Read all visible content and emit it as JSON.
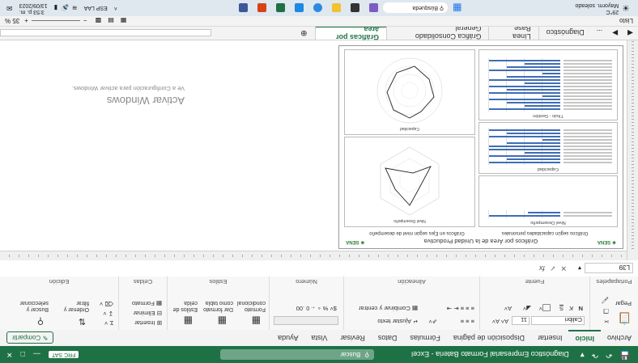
{
  "title_bar": {
    "document_title": "Diagnóstico Empresarial Formato Bateria  -  Excel",
    "search_placeholder": "Buscar",
    "account_label": "FRC SAT",
    "autosave_icon": "save-icon",
    "undo_icon": "undo-icon",
    "redo_icon": "redo-icon"
  },
  "menu": {
    "tabs": [
      "Archivo",
      "Inicio",
      "Insertar",
      "Disposición de página",
      "Fórmulas",
      "Datos",
      "Revisar",
      "Vista",
      "Ayuda"
    ],
    "active_tab": "Inicio",
    "share_label": "Compartir"
  },
  "ribbon": {
    "clipboard": {
      "label": "Portapapeles",
      "paste_label": "Pegar"
    },
    "font": {
      "label": "Fuente",
      "font_name": "Calibri",
      "font_size": "11",
      "bold": "N",
      "italic": "K",
      "underline": "S"
    },
    "alignment": {
      "label": "Alineación",
      "wrap_label": "Ajustar texto",
      "merge_label": "Combinar y centrar"
    },
    "number": {
      "label": "Número",
      "format_value": ""
    },
    "styles": {
      "label": "Estilos",
      "conditional_label": "Formato condicional",
      "table_label": "Dar formato como tabla",
      "cell_styles_label": "Estilos de celda"
    },
    "cells": {
      "label": "Celdas",
      "insert_label": "Insertar",
      "delete_label": "Eliminar",
      "format_label": "Formato"
    },
    "editing": {
      "label": "Edición",
      "sort_label": "Ordenar y filtrar",
      "find_label": "Buscar y seleccionar"
    }
  },
  "formula_bar": {
    "name_box": "L39",
    "fx_label": "fx",
    "formula": ""
  },
  "sheet": {
    "page_title": "Gráficos por Área de la Unidad Productiva",
    "left_chart_title": "Gráficos según capacidades personales",
    "right_chart_title": "Gráficos en Ejes según nivel de desempeño",
    "chart1_title": "Nivel Desempeño",
    "chart2_title": "Capacidad",
    "chart3_title": "Título - Gestión",
    "logo_text": "SENA"
  },
  "watermark": {
    "line1": "Activar Windows",
    "line2": "Ve a Configuración para activar Windows."
  },
  "sheet_tabs": {
    "items": [
      "Diagnóstico",
      "Línea Base",
      "Gráfica Consolidado General",
      "Gráficas por área"
    ],
    "active": "Gráficas por área",
    "ellipsis": "...",
    "add_icon": "plus-icon"
  },
  "status_bar": {
    "left": "Listo",
    "zoom": "35 %"
  },
  "taskbar": {
    "weather_temp": "29°C",
    "weather_desc": "Mayorm. soleado",
    "search_label": "Búsqueda",
    "clock_time": "3:53 p. m.",
    "clock_date": "13/09/2023",
    "lang": "ESP LAA"
  },
  "colors": {
    "excel_green": "#1e7145",
    "bar_blue": "#3f6db5"
  }
}
